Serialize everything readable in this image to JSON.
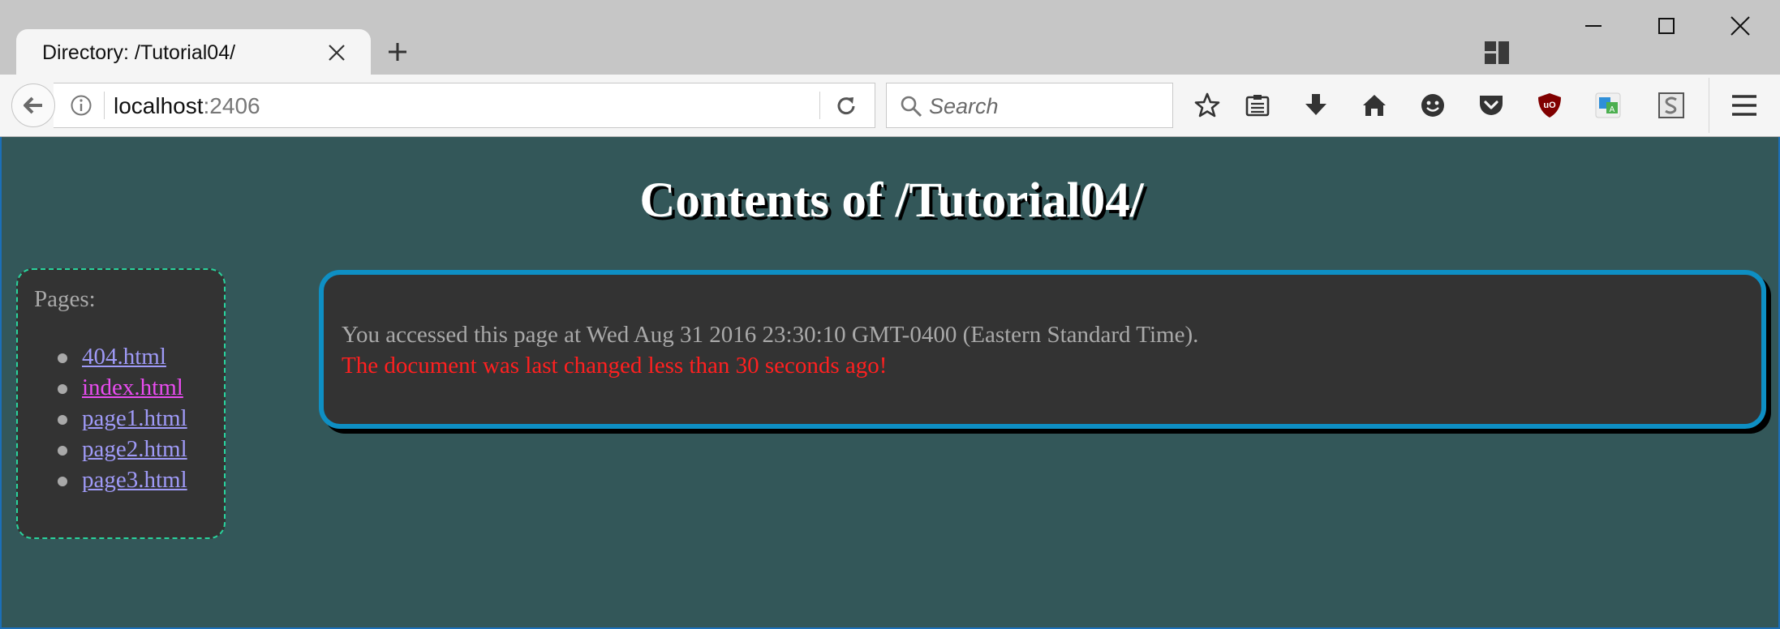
{
  "browser": {
    "tab_title": "Directory: /Tutorial04/",
    "url_host": "localhost",
    "url_port": ":2406",
    "search_placeholder": "Search"
  },
  "page": {
    "heading": "Contents of /Tutorial04/",
    "sidebar": {
      "label": "Pages:",
      "links": [
        "404.html",
        "index.html",
        "page1.html",
        "page2.html",
        "page3.html"
      ],
      "visited_index": 1
    },
    "info": {
      "access_line": "You accessed this page at Wed Aug 31 2016 23:30:10 GMT-0400 (Eastern Standard Time).",
      "changed_line": "The document was last changed less than 30 seconds ago!"
    }
  },
  "colors": {
    "page_background": "#335759",
    "panel_background": "#333333",
    "sidebar_border": "#29d39c",
    "info_border": "#0e8fc4",
    "link": "#9f9af7",
    "visited_link": "#e94cf0",
    "warning_text": "#ff2020"
  },
  "icons": {
    "tab_close": "close-icon",
    "new_tab": "plus-icon",
    "tab_groups": "tab-groups-icon",
    "back": "back-arrow-icon",
    "site_info": "info-icon",
    "reload": "reload-icon",
    "search": "search-icon",
    "toolbar": [
      "bookmark-star-icon",
      "reading-list-icon",
      "download-icon",
      "home-icon",
      "emoji-icon",
      "pocket-icon",
      "ublock-icon",
      "translate-icon",
      "stylish-icon",
      "menu-icon"
    ]
  }
}
